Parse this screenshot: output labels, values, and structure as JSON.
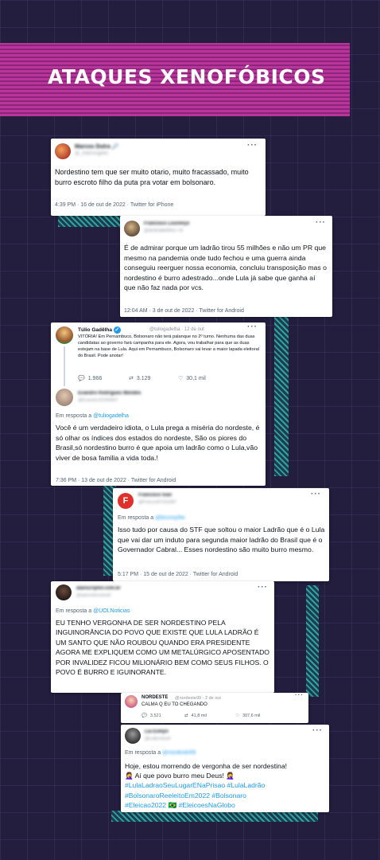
{
  "banner": {
    "title": "ATAQUES XENOFÓBICOS"
  },
  "tweets": {
    "t1": {
      "name": "Marcos Dutra 🔎",
      "handle": "@_marcosgoes",
      "text": "Nordestino tem que ser muito otario, muito fracassado, muito burro escroto filho da puta pra votar em bolsonaro.",
      "meta": "4:39 PM · 16 de out de 2022 · Twitter for iPhone"
    },
    "t2": {
      "name": "Francisco Lourenço",
      "handle": "@andradefilho778",
      "text": "É de admirar porque um ladrão tirou 55 milhões e não um PR que mesmo na pandemia onde tudo fechou e uma guerra ainda conseguiu reerguer nossa economia, concluiu transposição mas o nordestino é burro adestrado...onde Lula já sabe que ganha aí que não faz nada por vcs.",
      "meta": "12:04 AM · 3 de out de 2022 · Twitter for Android"
    },
    "t3": {
      "name": "Túlio Gadêlha",
      "handle": "@tuliogadelha · 12 de out",
      "text": "VITÓRIA! Em Pernambuco, Bolsonaro não terá palanque no 2º turno. Nenhuma das duas candidatas ao governo fará campanha para ele. Agora, vou trabalhar para que as duas estejam na base de Lula. Aqui em Pernambuco, Bolsonaro vai levar a maior lapada eleitoral do Brasil. Pode anotar!",
      "replies": "1.966",
      "retweets": "3.129",
      "likes": "30,1 mil"
    },
    "t4": {
      "name": "Evandro Rodrigues Mendes",
      "handle": "@Evandro31050847",
      "reply_prefix": "Em resposta a",
      "reply_to": "@tuliogadelha",
      "text": "Você é um verdadeiro idiota, o Lula prega a miséria do nordeste, é só olhar os índices dos estados do nordeste, São os piores do Brasil,só nordestino burro é que apoia um ladrão como o Lula,vão viver de bosa familia a vida toda.!",
      "meta": "7:36 PM · 13 de out de 2022 · Twitter for Android"
    },
    "t5": {
      "name": "Francisco Ivan",
      "handle": "@Francis87316387",
      "reply_prefix": "Em resposta a",
      "reply_to": "@brunoy9w",
      "text": "Isso tudo por causa do STF que soltou o maior Ladrão que é o Lula que vai dar um induto para segunda maior ladrão do Brasil que é o Governador Cabral... Esses nordestino são muito burro mesmo.",
      "meta": "5:17 PM · 15 de out de 2022 · Twitter for Android"
    },
    "t6": {
      "name": "alanscriptor.com.br",
      "handle": "@alanmbicicleta9",
      "reply_prefix": "Em resposta a",
      "reply_to": "@UOLNoticias",
      "text": "EU TENHO VERGONHA DE SER NORDESTINO PELA INGUINORÂNCIA DO POVO QUE EXISTE QUE LULA LADRÃO É UM SANTO QUE NÃO ROUBOU QUANDO ERA PRESIDENTE AGORA ME EXPLIQUEM COMO UM METALÚRGICO APOSENTADO POR INVALIDEZ FICOU MILIONÁRIO BEM COMO SEUS FILHOS. O POVO É BURRO E IGUINORANTE."
    },
    "t7": {
      "name": "NORDESTE",
      "handle": "@nordeste99 · 2 de out",
      "text": "CALMA Q EU TO CHEGANDO",
      "replies": "3.521",
      "retweets": "41,8 mil",
      "likes": "307,6 mil"
    },
    "t8": {
      "name": "Lia Evelyn",
      "handle": "@LiaEvelyn9",
      "reply_prefix": "Em resposta a",
      "reply_to": "@nordeste99",
      "line1": "Hoje, estou morrendo de vergonha de ser nordestina!",
      "line2": "🤦‍♀️ Aí que povo burro meu Deus! 🤦‍♀️",
      "tags1": "#LulaLadraoSeuLugarENaPrisao #LulaLadrão",
      "tags2": "#BolsonaroReeleitoEm2022 #Bolsonaro",
      "tags3a": "#Eleicao2022",
      "tags3b": "#EleicoesNaGlobo"
    }
  },
  "icons": {
    "reply": "reply-icon",
    "retweet": "retweet-icon",
    "like": "heart-icon",
    "more": "more-dots-icon",
    "verified": "verified-badge-icon"
  },
  "colors": {
    "background": "#231d3e",
    "banner": "#b8359c",
    "link": "#1d9bf0",
    "accent_teal": "#2fa3a0"
  }
}
